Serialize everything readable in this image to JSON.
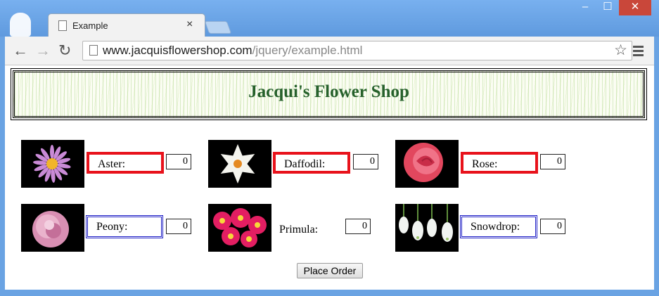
{
  "browser": {
    "tab_title": "Example",
    "tab_close": "×",
    "url_host": "www.jacquisflowershop.com",
    "url_path": "/jquery/example.html",
    "window_controls": {
      "minimize": "–",
      "maximize": "☐",
      "close": "✕"
    },
    "nav": {
      "back": "←",
      "forward": "→",
      "reload": "↻"
    }
  },
  "page": {
    "heading": "Jacqui's Flower Shop",
    "order_button": "Place Order",
    "flowers": [
      {
        "name": "Aster:",
        "value": "0"
      },
      {
        "name": "Daffodil:",
        "value": "0"
      },
      {
        "name": "Rose:",
        "value": "0"
      },
      {
        "name": "Peony:",
        "value": "0"
      },
      {
        "name": "Primula:",
        "value": "0"
      },
      {
        "name": "Snowdrop:",
        "value": "0"
      }
    ]
  },
  "colors": {
    "heading": "#26612b",
    "red_border": "#e8121b",
    "blue_border": "#1d1dc5",
    "chrome": "#6aa3e3"
  },
  "icons": [
    "profile-icon",
    "page-icon",
    "close-icon",
    "back-icon",
    "forward-icon",
    "reload-icon",
    "star-icon",
    "menu-icon"
  ]
}
